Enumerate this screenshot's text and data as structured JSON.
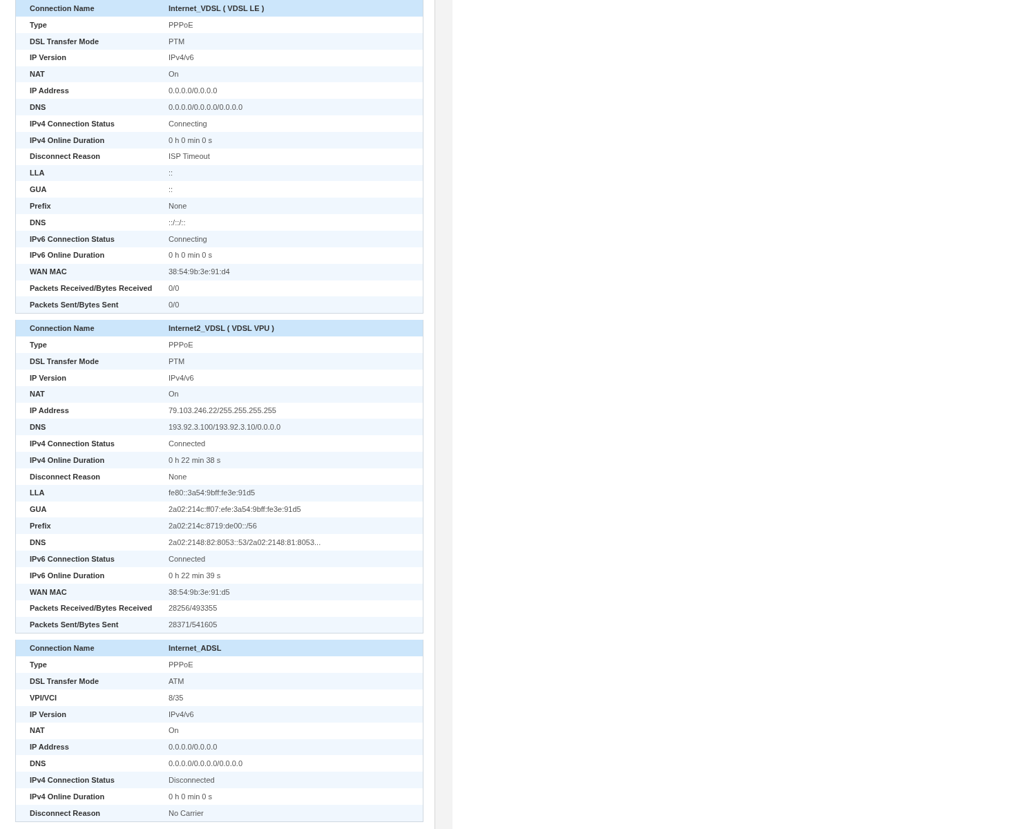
{
  "connections": [
    {
      "header": {
        "label": "Connection Name",
        "value": "Internet_VDSL ( VDSL LE )"
      },
      "rows": [
        {
          "label": "Type",
          "value": "PPPoE"
        },
        {
          "label": "DSL Transfer Mode",
          "value": "PTM"
        },
        {
          "label": "IP Version",
          "value": "IPv4/v6"
        },
        {
          "label": "NAT",
          "value": "On"
        },
        {
          "label": "IP Address",
          "value": "0.0.0.0/0.0.0.0"
        },
        {
          "label": "DNS",
          "value": "0.0.0.0/0.0.0.0/0.0.0.0"
        },
        {
          "label": "IPv4 Connection Status",
          "value": "Connecting"
        },
        {
          "label": "IPv4 Online Duration",
          "value": "0 h 0 min 0 s"
        },
        {
          "label": "Disconnect Reason",
          "value": "ISP Timeout"
        },
        {
          "label": "LLA",
          "value": "::"
        },
        {
          "label": "GUA",
          "value": "::"
        },
        {
          "label": "Prefix",
          "value": "None"
        },
        {
          "label": "DNS",
          "value": "::/::/::"
        },
        {
          "label": "IPv6 Connection Status",
          "value": "Connecting"
        },
        {
          "label": "IPv6 Online Duration",
          "value": "0 h 0 min 0 s"
        },
        {
          "label": "WAN MAC",
          "value": "38:54:9b:3e:91:d4"
        },
        {
          "label": "Packets Received/Bytes Received",
          "value": "0/0"
        },
        {
          "label": "Packets Sent/Bytes Sent",
          "value": "0/0"
        }
      ]
    },
    {
      "header": {
        "label": "Connection Name",
        "value": "Internet2_VDSL ( VDSL VPU )"
      },
      "rows": [
        {
          "label": "Type",
          "value": "PPPoE"
        },
        {
          "label": "DSL Transfer Mode",
          "value": "PTM"
        },
        {
          "label": "IP Version",
          "value": "IPv4/v6"
        },
        {
          "label": "NAT",
          "value": "On"
        },
        {
          "label": "IP Address",
          "value": "79.103.246.22/255.255.255.255"
        },
        {
          "label": "DNS",
          "value": "193.92.3.100/193.92.3.10/0.0.0.0"
        },
        {
          "label": "IPv4 Connection Status",
          "value": "Connected"
        },
        {
          "label": "IPv4 Online Duration",
          "value": "0 h 22 min 38 s"
        },
        {
          "label": "Disconnect Reason",
          "value": "None"
        },
        {
          "label": "LLA",
          "value": "fe80::3a54:9bff:fe3e:91d5"
        },
        {
          "label": "GUA",
          "value": "2a02:214c:ff07:efe:3a54:9bff:fe3e:91d5"
        },
        {
          "label": "Prefix",
          "value": "2a02:214c:8719:de00::/56"
        },
        {
          "label": "DNS",
          "value": "2a02:2148:82:8053::53/2a02:2148:81:8053..."
        },
        {
          "label": "IPv6 Connection Status",
          "value": "Connected"
        },
        {
          "label": "IPv6 Online Duration",
          "value": "0 h 22 min 39 s"
        },
        {
          "label": "WAN MAC",
          "value": "38:54:9b:3e:91:d5"
        },
        {
          "label": "Packets Received/Bytes Received",
          "value": "28256/493355"
        },
        {
          "label": "Packets Sent/Bytes Sent",
          "value": "28371/541605"
        }
      ]
    },
    {
      "header": {
        "label": "Connection Name",
        "value": "Internet_ADSL"
      },
      "rows": [
        {
          "label": "Type",
          "value": "PPPoE"
        },
        {
          "label": "DSL Transfer Mode",
          "value": "ATM"
        },
        {
          "label": "VPI/VCI",
          "value": "8/35"
        },
        {
          "label": "IP Version",
          "value": "IPv4/v6"
        },
        {
          "label": "NAT",
          "value": "On"
        },
        {
          "label": "IP Address",
          "value": "0.0.0.0/0.0.0.0"
        },
        {
          "label": "DNS",
          "value": "0.0.0.0/0.0.0.0/0.0.0.0"
        },
        {
          "label": "IPv4 Connection Status",
          "value": "Disconnected"
        },
        {
          "label": "IPv4 Online Duration",
          "value": "0 h 0 min 0 s"
        },
        {
          "label": "Disconnect Reason",
          "value": "No Carrier"
        }
      ]
    }
  ]
}
